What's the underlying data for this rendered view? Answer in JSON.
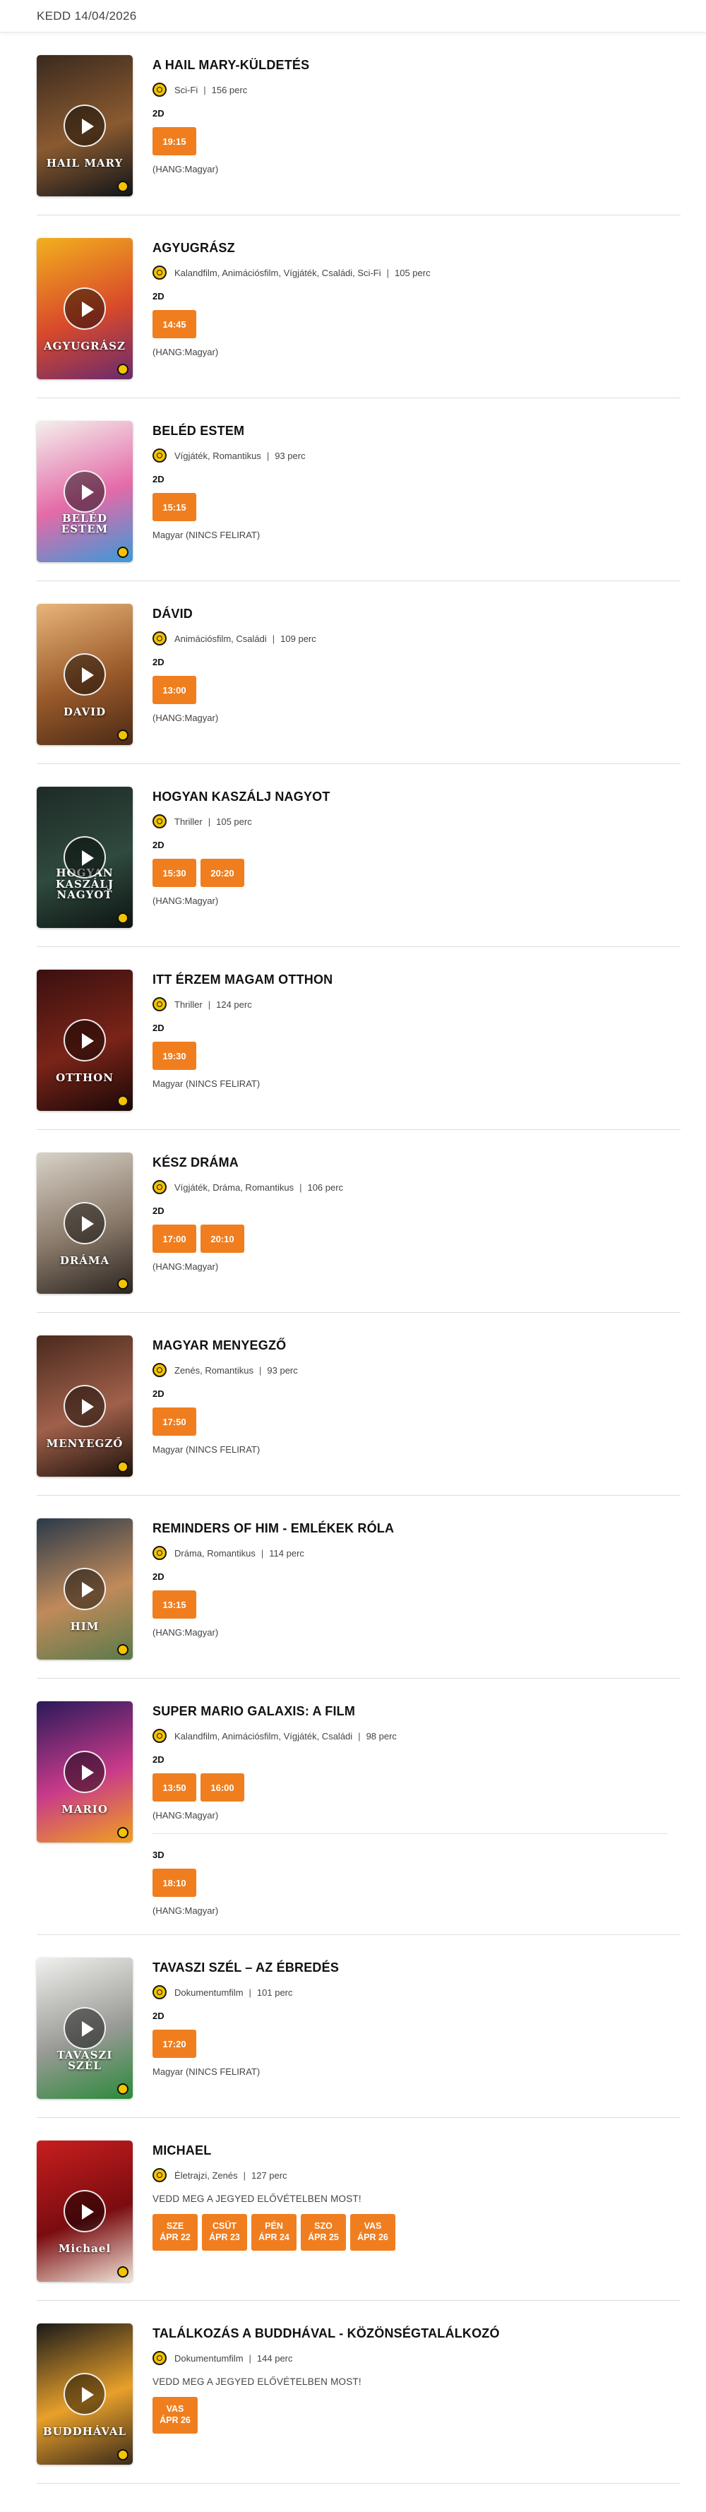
{
  "header": {
    "date": "KEDD 14/04/2026"
  },
  "play_label": "",
  "movies": [
    {
      "title": "A HAIL MARY-KÜLDETÉS",
      "genres": "Sci-Fi",
      "duration": "156 perc",
      "poster": {
        "text": "HAIL MARY",
        "c1": "#3a2a1e",
        "c2": "#8a5a30",
        "c3": "#101418"
      },
      "blocks": [
        {
          "format": "2D",
          "times": [
            "19:15"
          ],
          "lang": "(HANG:Magyar)"
        }
      ]
    },
    {
      "title": "AGYUGRÁSZ",
      "genres": "Kalandfilm, Animációsfilm, Vígjáték, Családi, Sci-Fi",
      "duration": "105 perc",
      "poster": {
        "text": "AGYUGRÁSZ",
        "c1": "#f2b01e",
        "c2": "#d94a2a",
        "c3": "#6a2a6e"
      },
      "blocks": [
        {
          "format": "2D",
          "times": [
            "14:45"
          ],
          "lang": "(HANG:Magyar)"
        }
      ]
    },
    {
      "title": "BELÉD ESTEM",
      "genres": "Vígjáték, Romantikus",
      "duration": "93 perc",
      "poster": {
        "text": "BELÉD ESTEM",
        "c1": "#f4f0ec",
        "c2": "#e46aa8",
        "c3": "#3a9ad9"
      },
      "blocks": [
        {
          "format": "2D",
          "times": [
            "15:15"
          ],
          "lang": "Magyar (NINCS FELIRAT)"
        }
      ]
    },
    {
      "title": "DÁVID",
      "genres": "Animációsfilm, Családi",
      "duration": "109 perc",
      "poster": {
        "text": "DAVID",
        "c1": "#e8b57a",
        "c2": "#9a5a2a",
        "c3": "#4a2a16"
      },
      "blocks": [
        {
          "format": "2D",
          "times": [
            "13:00"
          ],
          "lang": "(HANG:Magyar)"
        }
      ]
    },
    {
      "title": "HOGYAN KASZÁLJ NAGYOT",
      "genres": "Thriller",
      "duration": "105 perc",
      "poster": {
        "text": "HOGYAN KASZÁLJ NAGYOT",
        "c1": "#1e2a26",
        "c2": "#2f4a3e",
        "c3": "#0e1412"
      },
      "blocks": [
        {
          "format": "2D",
          "times": [
            "15:30",
            "20:20"
          ],
          "lang": "(HANG:Magyar)"
        }
      ]
    },
    {
      "title": "ITT ÉRZEM MAGAM OTTHON",
      "genres": "Thriller",
      "duration": "124 perc",
      "poster": {
        "text": "OTTHON",
        "c1": "#3a1010",
        "c2": "#7a2418",
        "c3": "#1a0808"
      },
      "blocks": [
        {
          "format": "2D",
          "times": [
            "19:30"
          ],
          "lang": "Magyar (NINCS FELIRAT)"
        }
      ]
    },
    {
      "title": "KÉSZ DRÁMA",
      "genres": "Vígjáték, Dráma, Romantikus",
      "duration": "106 perc",
      "poster": {
        "text": "DRÁMA",
        "c1": "#d8d2c8",
        "c2": "#8a7a6a",
        "c3": "#2a2420"
      },
      "blocks": [
        {
          "format": "2D",
          "times": [
            "17:00",
            "20:10"
          ],
          "lang": "(HANG:Magyar)"
        }
      ]
    },
    {
      "title": "MAGYAR MENYEGZŐ",
      "genres": "Zenés, Romantikus",
      "duration": "93 perc",
      "poster": {
        "text": "MENYEGZŐ",
        "c1": "#4a2a1e",
        "c2": "#a0604a",
        "c3": "#1e120c"
      },
      "blocks": [
        {
          "format": "2D",
          "times": [
            "17:50"
          ],
          "lang": "Magyar (NINCS FELIRAT)"
        }
      ]
    },
    {
      "title": "REMINDERS OF HIM - EMLÉKEK RÓLA",
      "genres": "Dráma, Romantikus",
      "duration": "114 perc",
      "poster": {
        "text": "HIM",
        "c1": "#2a3a4a",
        "c2": "#c08a5a",
        "c3": "#5a7a4a"
      },
      "blocks": [
        {
          "format": "2D",
          "times": [
            "13:15"
          ],
          "lang": "(HANG:Magyar)"
        }
      ]
    },
    {
      "title": "SUPER MARIO GALAXIS: A FILM",
      "genres": "Kalandfilm, Animációsfilm, Vígjáték, Családi",
      "duration": "98 perc",
      "poster": {
        "text": "MARIO",
        "c1": "#2a1a5a",
        "c2": "#c83a8a",
        "c3": "#f0a020"
      },
      "blocks": [
        {
          "format": "2D",
          "times": [
            "13:50",
            "16:00"
          ],
          "lang": "(HANG:Magyar)"
        },
        {
          "format": "3D",
          "times": [
            "18:10"
          ],
          "lang": "(HANG:Magyar)"
        }
      ]
    },
    {
      "title": "TAVASZI SZÉL – AZ ÉBREDÉS",
      "genres": "Dokumentumfilm",
      "duration": "101 perc",
      "poster": {
        "text": "TAVASZI SZÉL",
        "c1": "#f0f0ee",
        "c2": "#9a9a96",
        "c3": "#2a8a3a"
      },
      "blocks": [
        {
          "format": "2D",
          "times": [
            "17:20"
          ],
          "lang": "Magyar (NINCS FELIRAT)"
        }
      ]
    },
    {
      "title": "MICHAEL",
      "genres": "Életrajzi, Zenés",
      "duration": "127 perc",
      "poster": {
        "text": "Michael",
        "c1": "#c81e1e",
        "c2": "#7a0c10",
        "c3": "#f2e6d8"
      },
      "presale": "VEDD MEG A JEGYED ELŐVÉTELBEN MOST!",
      "dates": [
        [
          "SZE",
          "ÁPR 22"
        ],
        [
          "CSÜT",
          "ÁPR 23"
        ],
        [
          "PÉN",
          "ÁPR 24"
        ],
        [
          "SZO",
          "ÁPR 25"
        ],
        [
          "VAS",
          "ÁPR 26"
        ]
      ]
    },
    {
      "title": "TALÁLKOZÁS A BUDDHÁVAL - KÖZÖNSÉGTALÁLKOZÓ",
      "genres": "Dokumentumfilm",
      "duration": "144 perc",
      "poster": {
        "text": "BUDDHÁVAL",
        "c1": "#1a1a1a",
        "c2": "#e8a02a",
        "c3": "#3a2a1a"
      },
      "presale": "VEDD MEG A JEGYED ELŐVÉTELBEN MOST!",
      "dates": [
        [
          "VAS",
          "ÁPR 26"
        ]
      ]
    }
  ]
}
